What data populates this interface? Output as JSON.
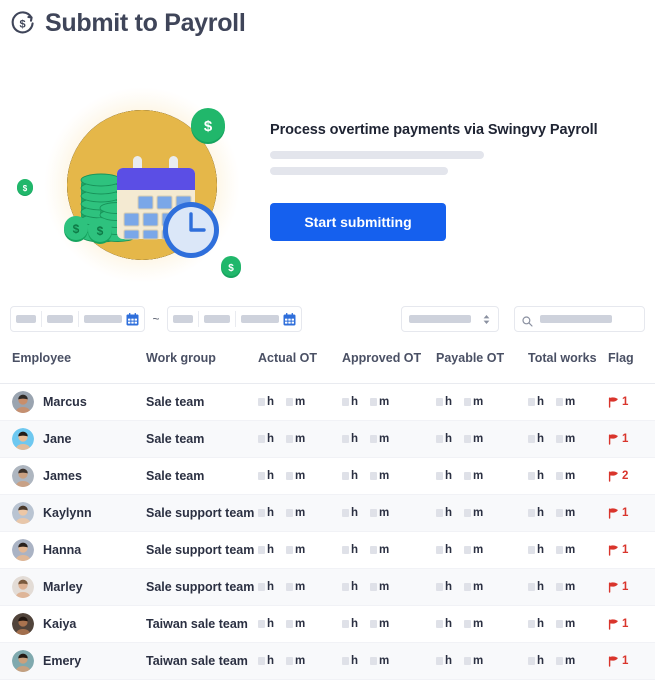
{
  "header": {
    "title": "Submit to Payroll",
    "logo_icon": "dollar-refresh-icon"
  },
  "hero": {
    "illustration": "payroll-calendar-coins-clock-illustration",
    "heading": "Process overtime payments via Swingvy Payroll",
    "skeleton_lines": 2,
    "cta_label": "Start submitting",
    "cta_color": "#1560ee"
  },
  "filters": {
    "date_from": {
      "value": "",
      "placeholder": "",
      "icon": "calendar-icon",
      "segments": [
        "",
        "",
        ""
      ]
    },
    "range_separator": "~",
    "date_to": {
      "value": "",
      "placeholder": "",
      "icon": "calendar-icon",
      "segments": [
        "",
        "",
        ""
      ]
    },
    "status_select": {
      "value": "",
      "icon": "stepper-updown-icon"
    },
    "search": {
      "value": "",
      "placeholder": "",
      "icon": "search-icon"
    }
  },
  "table": {
    "columns": [
      "Employee",
      "Work group",
      "Actual OT",
      "Approved OT",
      "Payable OT",
      "Total works",
      "Flag"
    ],
    "unit_hour": "h",
    "unit_minute": "m",
    "flag_icon": "flag-icon",
    "rows": [
      {
        "avatar": "avatar-marcus",
        "employee": "Marcus",
        "work_group": "Sale team",
        "actual_ot": {
          "hours": "",
          "minutes": ""
        },
        "approved_ot": {
          "hours": "",
          "minutes": ""
        },
        "payable_ot": {
          "hours": "",
          "minutes": ""
        },
        "total_works": {
          "hours": "",
          "minutes": ""
        },
        "flag_count": "1"
      },
      {
        "avatar": "avatar-jane",
        "employee": "Jane",
        "work_group": "Sale team",
        "actual_ot": {
          "hours": "",
          "minutes": ""
        },
        "approved_ot": {
          "hours": "",
          "minutes": ""
        },
        "payable_ot": {
          "hours": "",
          "minutes": ""
        },
        "total_works": {
          "hours": "",
          "minutes": ""
        },
        "flag_count": "1"
      },
      {
        "avatar": "avatar-james",
        "employee": "James",
        "work_group": "Sale team",
        "actual_ot": {
          "hours": "",
          "minutes": ""
        },
        "approved_ot": {
          "hours": "",
          "minutes": ""
        },
        "payable_ot": {
          "hours": "",
          "minutes": ""
        },
        "total_works": {
          "hours": "",
          "minutes": ""
        },
        "flag_count": "2"
      },
      {
        "avatar": "avatar-kaylynn",
        "employee": "Kaylynn",
        "work_group": "Sale support team",
        "actual_ot": {
          "hours": "",
          "minutes": ""
        },
        "approved_ot": {
          "hours": "",
          "minutes": ""
        },
        "payable_ot": {
          "hours": "",
          "minutes": ""
        },
        "total_works": {
          "hours": "",
          "minutes": ""
        },
        "flag_count": "1"
      },
      {
        "avatar": "avatar-hanna",
        "employee": "Hanna",
        "work_group": "Sale support team",
        "actual_ot": {
          "hours": "",
          "minutes": ""
        },
        "approved_ot": {
          "hours": "",
          "minutes": ""
        },
        "payable_ot": {
          "hours": "",
          "minutes": ""
        },
        "total_works": {
          "hours": "",
          "minutes": ""
        },
        "flag_count": "1"
      },
      {
        "avatar": "avatar-marley",
        "employee": "Marley",
        "work_group": "Sale support team",
        "actual_ot": {
          "hours": "",
          "minutes": ""
        },
        "approved_ot": {
          "hours": "",
          "minutes": ""
        },
        "payable_ot": {
          "hours": "",
          "minutes": ""
        },
        "total_works": {
          "hours": "",
          "minutes": ""
        },
        "flag_count": "1"
      },
      {
        "avatar": "avatar-kaiya",
        "employee": "Kaiya",
        "work_group": "Taiwan sale team",
        "actual_ot": {
          "hours": "",
          "minutes": ""
        },
        "approved_ot": {
          "hours": "",
          "minutes": ""
        },
        "payable_ot": {
          "hours": "",
          "minutes": ""
        },
        "total_works": {
          "hours": "",
          "minutes": ""
        },
        "flag_count": "1"
      },
      {
        "avatar": "avatar-emery",
        "employee": "Emery",
        "work_group": "Taiwan sale team",
        "actual_ot": {
          "hours": "",
          "minutes": ""
        },
        "approved_ot": {
          "hours": "",
          "minutes": ""
        },
        "payable_ot": {
          "hours": "",
          "minutes": ""
        },
        "total_works": {
          "hours": "",
          "minutes": ""
        },
        "flag_count": "1"
      }
    ]
  },
  "colors": {
    "accent": "#1560ee",
    "flag": "#d9352c",
    "title": "#3f4559",
    "skeleton": "#ced2dc",
    "row_alt": "#f8f9fb"
  }
}
